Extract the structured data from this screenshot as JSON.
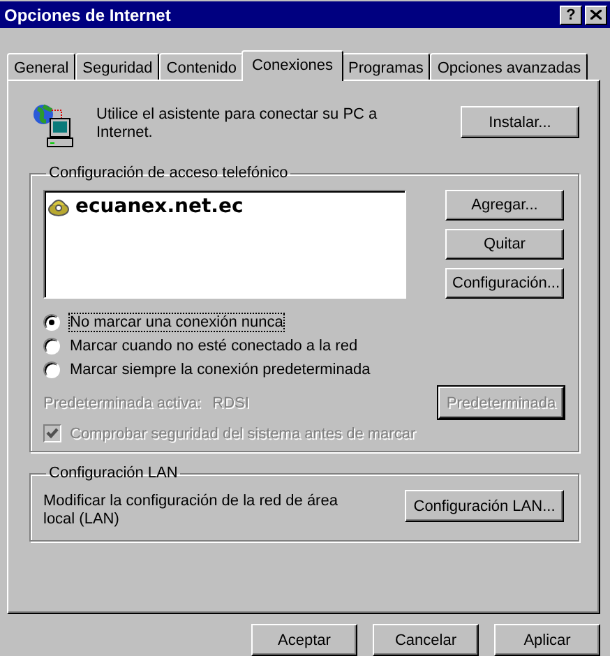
{
  "window": {
    "title": "Opciones de Internet",
    "help_button": "?"
  },
  "tabs": [
    {
      "label": "General",
      "selected": false
    },
    {
      "label": "Seguridad",
      "selected": false
    },
    {
      "label": "Contenido",
      "selected": false
    },
    {
      "label": "Conexiones",
      "selected": true
    },
    {
      "label": "Programas",
      "selected": false
    },
    {
      "label": "Opciones avanzadas",
      "selected": false
    }
  ],
  "setup": {
    "text": "Utilice el asistente para conectar su PC a Internet.",
    "button": "Instalar..."
  },
  "dialup": {
    "title": "Configuración de acceso telefónico",
    "connections": [
      {
        "name": "ecuanex.net.ec"
      }
    ],
    "buttons": [
      "Agregar...",
      "Quitar",
      "Configuración..."
    ],
    "dial_options": [
      {
        "label": "No marcar una conexión nunca",
        "selected": true
      },
      {
        "label": "Marcar cuando no esté conectado a la red",
        "selected": false
      },
      {
        "label": "Marcar siempre la conexión predeterminada",
        "selected": false
      }
    ],
    "default_label": "Predeterminada activa:",
    "default_value": "RDSI",
    "default_disabled": true,
    "default_button": {
      "label": "Predeterminada",
      "disabled": true
    },
    "security_check": {
      "label": "Comprobar seguridad del sistema antes de marcar",
      "checked": true,
      "disabled": true
    }
  },
  "lan": {
    "title": "Configuración LAN",
    "text": "Modificar la configuración de la red de área local (LAN)",
    "button": "Configuración LAN..."
  },
  "footer_buttons": [
    "Aceptar",
    "Cancelar",
    "Aplicar"
  ]
}
